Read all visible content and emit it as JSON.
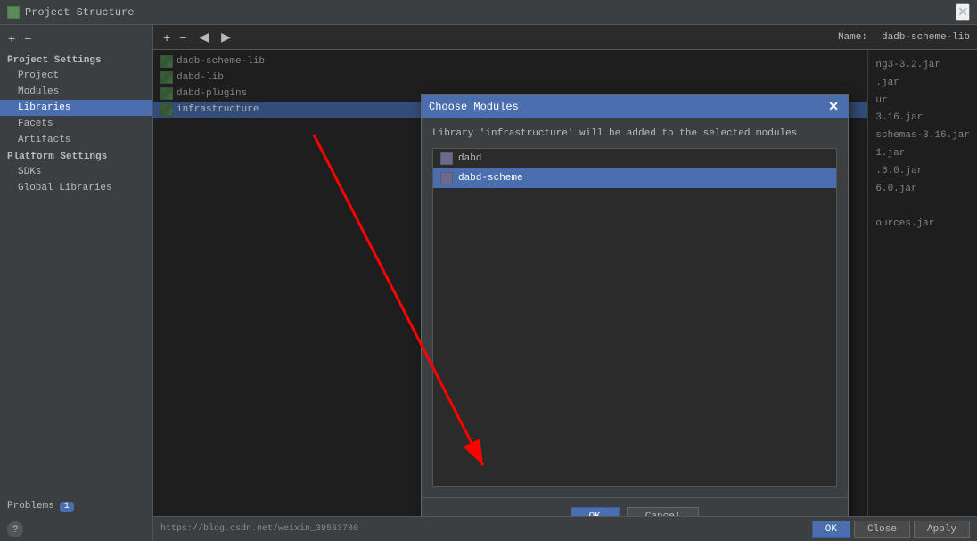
{
  "titleBar": {
    "icon": "⬛",
    "title": "Project Structure",
    "closeLabel": "✕"
  },
  "toolbar": {
    "addLabel": "+",
    "removeLabel": "−",
    "backLabel": "◀",
    "forwardLabel": "▶",
    "nameLabel": "Name:",
    "nameValue": "dadb-scheme-lib"
  },
  "sidebar": {
    "projectSettingsLabel": "Project Settings",
    "items": [
      {
        "id": "project",
        "label": "Project",
        "active": false
      },
      {
        "id": "modules",
        "label": "Modules",
        "active": false
      },
      {
        "id": "libraries",
        "label": "Libraries",
        "active": true
      },
      {
        "id": "facets",
        "label": "Facets",
        "active": false
      },
      {
        "id": "artifacts",
        "label": "Artifacts",
        "active": false
      }
    ],
    "platformSettingsLabel": "Platform Settings",
    "platformItems": [
      {
        "id": "sdks",
        "label": "SDKs",
        "active": false
      },
      {
        "id": "global-libraries",
        "label": "Global Libraries",
        "active": false
      }
    ],
    "problemsLabel": "Problems",
    "problemsBadge": "1",
    "helpLabel": "?"
  },
  "libraryList": {
    "items": [
      {
        "id": "dadb-scheme-lib",
        "label": "dadb-scheme-lib",
        "active": false
      },
      {
        "id": "dabd-lib",
        "label": "dabd-lib",
        "active": false
      },
      {
        "id": "dabd-plugins",
        "label": "dabd-plugins",
        "active": false
      },
      {
        "id": "infrastructure",
        "label": "infrastructure",
        "active": true
      }
    ]
  },
  "jarFiles": {
    "items": [
      "ng3-3.2.jar",
      ".jar",
      "ur",
      "3.16.jar",
      "schemas-3.16.jar",
      "1.jar",
      ".6.0.jar",
      "6.0.jar",
      "",
      "ources.jar"
    ]
  },
  "modal": {
    "title": "Choose Modules",
    "closeLabel": "✕",
    "message": "Library 'infrastructure' will be added to the selected modules.",
    "modules": [
      {
        "id": "dabd",
        "label": "dabd",
        "selected": false
      },
      {
        "id": "dabd-scheme",
        "label": "dabd-scheme",
        "selected": true
      }
    ],
    "okLabel": "OK",
    "cancelLabel": "Cancel"
  },
  "bottomBar": {
    "okLabel": "OK",
    "cancelLabel": "Close",
    "applyLabel": "Apply",
    "url": "https://blog.csdn.net/weixin_39563780"
  }
}
